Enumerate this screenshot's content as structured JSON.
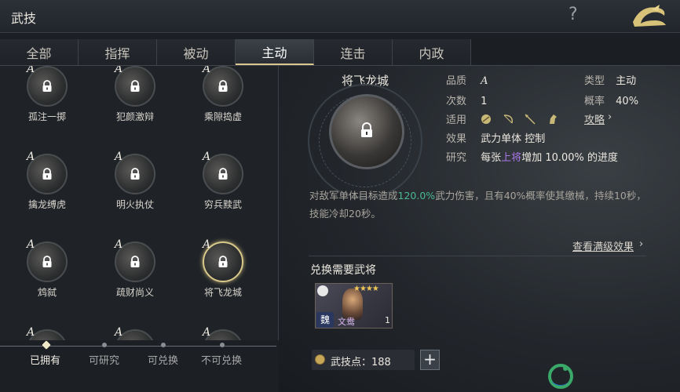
{
  "header": {
    "title": "武技",
    "help_icon": "question-mark-icon",
    "back_icon": "dragon-back-icon"
  },
  "tabs": [
    {
      "label": "全部",
      "active": false
    },
    {
      "label": "指挥",
      "active": false
    },
    {
      "label": "被动",
      "active": false
    },
    {
      "label": "主动",
      "active": true
    },
    {
      "label": "连击",
      "active": false
    },
    {
      "label": "内政",
      "active": false
    }
  ],
  "skills": [
    {
      "grade": "A",
      "name": "孤注一掷"
    },
    {
      "grade": "A",
      "name": "犯颜激辩"
    },
    {
      "grade": "A",
      "name": "乘隙捣虚"
    },
    {
      "grade": "A",
      "name": "擒龙缚虎"
    },
    {
      "grade": "A",
      "name": "明火执仗"
    },
    {
      "grade": "A",
      "name": "穷兵黩武"
    },
    {
      "grade": "A",
      "name": "鸩弑"
    },
    {
      "grade": "A",
      "name": "疏财尚义"
    },
    {
      "grade": "A",
      "name": "将飞龙城",
      "selected": true
    },
    {
      "grade": "A",
      "name": ""
    },
    {
      "grade": "A",
      "name": ""
    },
    {
      "grade": "A",
      "name": ""
    }
  ],
  "filters": [
    {
      "label": "已拥有",
      "active": true
    },
    {
      "label": "可研究",
      "active": false
    },
    {
      "label": "可兑换",
      "active": false
    },
    {
      "label": "不可兑换",
      "active": false
    }
  ],
  "detail": {
    "title": "将飞龙城",
    "quality_label": "品质",
    "quality_value": "A",
    "type_label": "类型",
    "type_value": "主动",
    "count_label": "次数",
    "count_value": "1",
    "rate_label": "概率",
    "rate_value": "40%",
    "applies_label": "适用",
    "applies_icons": [
      "shield-icon",
      "bow-icon",
      "spear-icon",
      "horse-icon"
    ],
    "strategy_link": "攻略",
    "effect_label": "效果",
    "effect_value": "武力单体 控制",
    "research_label": "研究",
    "research_prefix": "每张",
    "research_highlight": "上将",
    "research_suffix": "增加 10.00% 的进度",
    "description_pre": "对敌军单体目标造成",
    "description_hl": "120.0%",
    "description_post": "武力伤害，且有40%概率使其缴械，持续10秒，技能冷却20秒。",
    "max_effect_link": "查看满级效果"
  },
  "exchange": {
    "title": "兑换需要武将",
    "general": {
      "name": "文鸯",
      "faction": "魏",
      "level": "1",
      "stars": "★★★★"
    }
  },
  "points": {
    "label": "武技点：188"
  },
  "colors": {
    "accent": "#d9c98a",
    "highlight": "#4ab890",
    "research_hl": "#a878e8"
  }
}
